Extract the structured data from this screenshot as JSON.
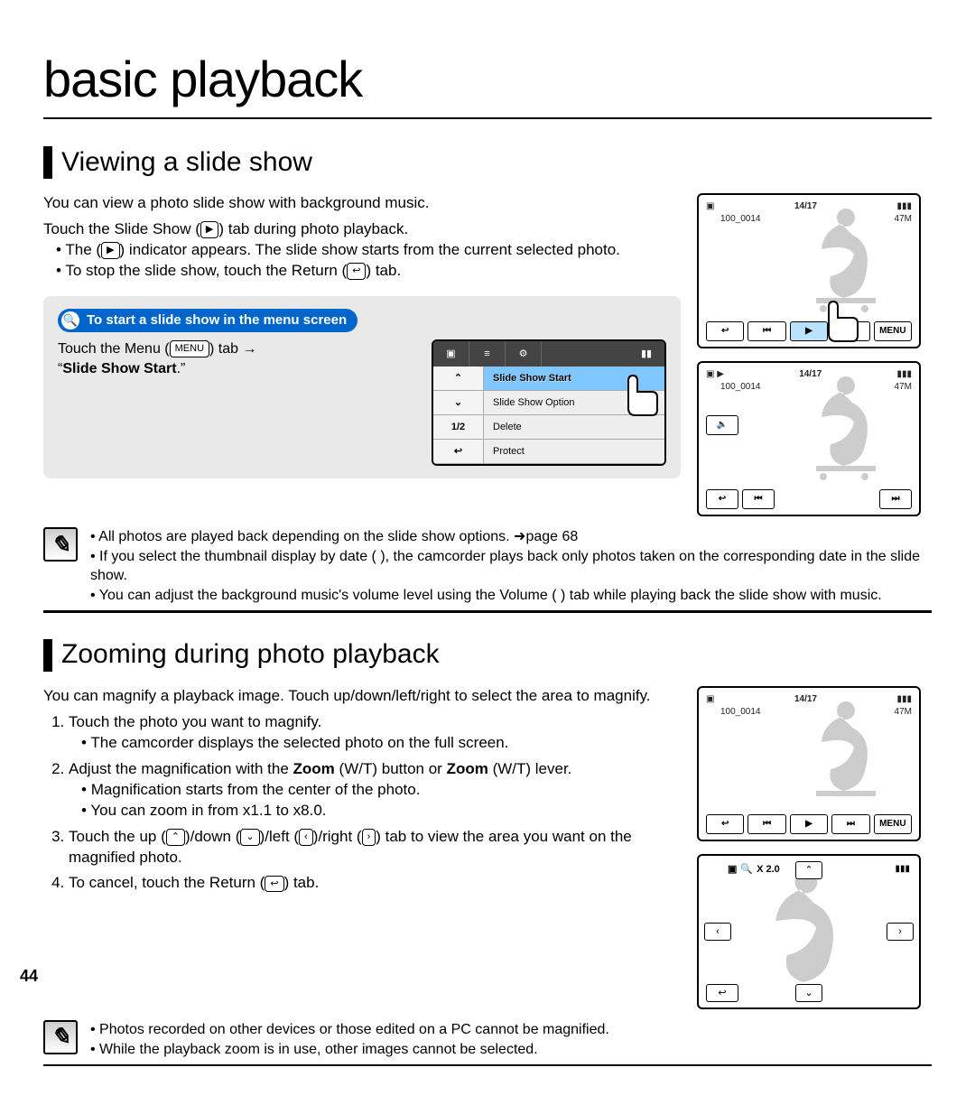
{
  "page_title": "basic playback",
  "page_number": "44",
  "section1": {
    "heading": "Viewing a slide show",
    "intro": "You can view a photo slide show with background music.",
    "line2a": "Touch the Slide Show (",
    "line2b": ") tab during photo playback.",
    "bullets": [
      {
        "a": "The (",
        "b": ") indicator appears. The slide show starts from the current selected photo."
      },
      {
        "a": "To stop the slide show, touch the Return (",
        "b": ") tab."
      }
    ],
    "tip_title": "To start a slide show in the menu screen",
    "tip_text_a": "Touch the Menu (",
    "tip_text_b": ") tab →",
    "tip_text_c": "“",
    "tip_text_bold": "Slide Show Start",
    "tip_text_d": ".”",
    "menu_items": [
      "Slide Show Start",
      "Slide Show Option",
      "Delete",
      "Protect"
    ],
    "menu_side": {
      "up": "⌃",
      "down": "⌄",
      "page": "1/2",
      "ret": "↩"
    },
    "notes": [
      "All photos are played back depending on the slide show options. ➜page 68",
      "If you select the thumbnail display by date (     ), the camcorder plays back only photos taken on the corresponding date in the slide show.",
      "You can adjust the background music's volume level using the Volume (     ) tab while playing back the slide show with music."
    ]
  },
  "section2": {
    "heading": "Zooming during photo playback",
    "intro": "You can magnify a playback image. Touch up/down/left/right to select the area to magnify.",
    "steps": [
      {
        "t": "Touch the photo you want to magnify.",
        "sub": [
          "The camcorder displays the selected photo on the full screen."
        ]
      },
      {
        "t_a": "Adjust the magnification with the ",
        "t_bold": "Zoom",
        "t_b": " (W/T) button or ",
        "t_bold2": "Zoom",
        "t_c": " (W/T) lever.",
        "sub": [
          "Magnification starts from the center of the photo.",
          "You can zoom in from x1.1 to x8.0."
        ]
      },
      {
        "t_a": "Touch the up (",
        "t_b": ")/down (",
        "t_c": ")/left (",
        "t_d": ")/right (",
        "t_e": ") tab to view the area you want on the magnified photo."
      },
      {
        "t_a": "To cancel, touch the Return (",
        "t_b": ") tab."
      }
    ],
    "notes": [
      "Photos recorded on other devices or those edited on a PC cannot be magnified.",
      "While the playback zoom is in use, other images cannot be selected."
    ]
  },
  "screens": {
    "counter": "14/17",
    "folder": "100_0014",
    "size": "47M",
    "menu_label": "MENU",
    "zoom_label": "X 2.0"
  },
  "icons": {
    "play": "▶",
    "prev": "⏮",
    "next": "⏭",
    "return": "↩",
    "volume": "🔈",
    "menu": "MENU",
    "up": "⌃",
    "down": "⌄",
    "left": "‹",
    "right": "›",
    "mag": "🔍",
    "photo": "▣",
    "battery": "▮▮▮"
  }
}
